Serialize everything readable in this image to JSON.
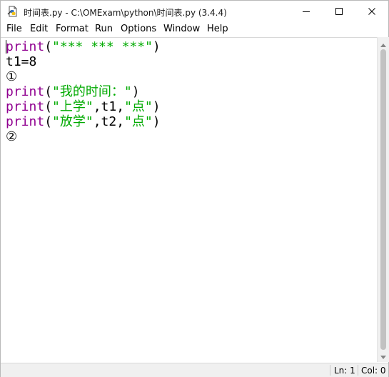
{
  "window": {
    "title": "时间表.py - C:\\OMExam\\python\\时间表.py (3.4.4)"
  },
  "menu": {
    "items": [
      "File",
      "Edit",
      "Format",
      "Run",
      "Options",
      "Window",
      "Help"
    ]
  },
  "editor": {
    "lines": [
      {
        "kw": "print",
        "p1": "(",
        "s1": "\"*** *** ***\"",
        "p2": ")",
        "s2": "",
        "p3": "",
        "s3": "",
        "p4": ""
      },
      {
        "kw": "",
        "p1": "t1=8",
        "s1": "",
        "p2": "",
        "s2": "",
        "p3": "",
        "s3": "",
        "p4": ""
      },
      {
        "kw": "",
        "p1": "①",
        "s1": "",
        "p2": "",
        "s2": "",
        "p3": "",
        "s3": "",
        "p4": ""
      },
      {
        "kw": "print",
        "p1": "(",
        "s1": "\"我的时间：\"",
        "p2": ")",
        "s2": "",
        "p3": "",
        "s3": "",
        "p4": ""
      },
      {
        "kw": "print",
        "p1": "(",
        "s1": "\"上学\"",
        "p2": ",t1,",
        "s2": "\"点\"",
        "p3": ")",
        "s3": "",
        "p4": ""
      },
      {
        "kw": "print",
        "p1": "(",
        "s1": "\"放学\"",
        "p2": ",t2,",
        "s2": "\"点\"",
        "p3": ")",
        "s3": "",
        "p4": ""
      },
      {
        "kw": "",
        "p1": "②",
        "s1": "",
        "p2": "",
        "s2": "",
        "p3": "",
        "s3": "",
        "p4": ""
      }
    ]
  },
  "status": {
    "line": "Ln: 1",
    "col": "Col: 0"
  },
  "colors": {
    "keyword": "#900090",
    "string": "#00aa00"
  },
  "icons": {
    "app": "idle-python-file-icon",
    "minimize": "minimize-icon",
    "maximize": "maximize-icon",
    "close": "close-icon"
  }
}
